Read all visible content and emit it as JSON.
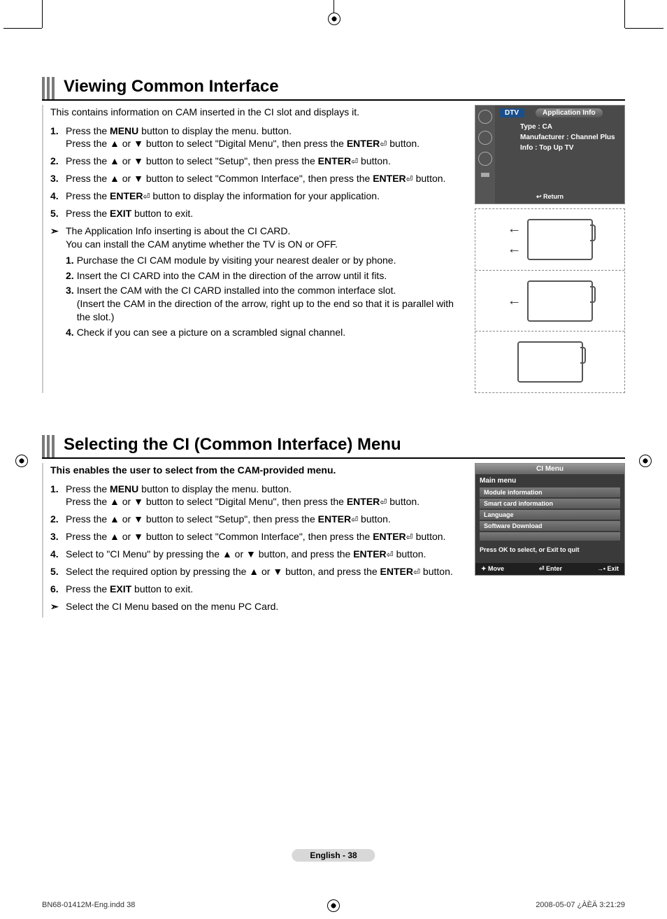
{
  "section1": {
    "title": "Viewing Common Interface",
    "intro": "This contains information on CAM inserted in the CI slot and displays it.",
    "steps": [
      {
        "num": "1.",
        "text_a": "Press the ",
        "b1": "MENU",
        "text_b": " button to display the menu.",
        "line2_a": "Press the ▲ or ▼ button to select \"Digital Menu\", then press the ",
        "b2": "ENTER",
        "tail": " button."
      },
      {
        "num": "2.",
        "text_a": "Press the ▲ or ▼ button to select \"Setup\", then press the ",
        "b1": "ENTER",
        "tail": " button."
      },
      {
        "num": "3.",
        "text_a": "Press the ▲ or ▼ button to select \"Common Interface\", then press the ",
        "b1": "ENTER",
        "tail": " button."
      },
      {
        "num": "4.",
        "text_a": "Press the ",
        "b1": "ENTER",
        "tail": " button to display the information for your application."
      },
      {
        "num": "5.",
        "text_a": "Press the ",
        "b1": "EXIT",
        "tail": " button to exit."
      }
    ],
    "note_line1": "The Application Info inserting is about the CI CARD.",
    "note_line2": "You can install the CAM anytime whether the TV is ON or OFF.",
    "sub": [
      {
        "num": "1.",
        "text": "Purchase the CI CAM module by visiting your nearest dealer or by phone."
      },
      {
        "num": "2.",
        "text": "Insert the CI CARD into the CAM in the direction of the arrow until it fits."
      },
      {
        "num": "3.",
        "text": "Insert the CAM with the CI CARD installed into the common interface slot.",
        "extra": "(Insert the CAM in the direction of the arrow, right up to the end so that it is parallel with the slot.)"
      },
      {
        "num": "4.",
        "text": "Check if you can see a picture on a scrambled signal channel."
      }
    ],
    "app_info": {
      "dtv": "DTV",
      "title": "Application Info",
      "type": "Type : CA",
      "mfr": "Manufacturer : Channel Plus",
      "info": "Info : Top Up TV",
      "return": "↩ Return"
    }
  },
  "section2": {
    "title": "Selecting the CI (Common Interface) Menu",
    "intro": "This enables the user to select from the CAM-provided menu.",
    "steps": [
      {
        "num": "1.",
        "text_a": "Press the ",
        "b1": "MENU",
        "text_b": " button to display the menu.",
        "line2_a": "Press the ▲ or ▼ button to select \"Digital Menu\", then press the ",
        "b2": "ENTER",
        "tail": " button."
      },
      {
        "num": "2.",
        "text_a": "Press the ▲ or ▼ button to select \"Setup\", then press the ",
        "b1": "ENTER",
        "tail": " button."
      },
      {
        "num": "3.",
        "text_a": "Press the ▲ or ▼ button to select \"Common Interface\", then press the ",
        "b1": "ENTER",
        "tail": " button."
      },
      {
        "num": "4.",
        "text_a": "Select to \"CI Menu\" by pressing the ▲ or ▼ button, and press the ",
        "b1": "ENTER",
        "tail": " button."
      },
      {
        "num": "5.",
        "text_a": "Select the required option by pressing the ▲ or ▼ button, and press the ",
        "b1": "ENTER",
        "tail": " button."
      },
      {
        "num": "6.",
        "text_a": "Press the ",
        "b1": "EXIT",
        "tail": " button to exit."
      }
    ],
    "note": "Select the CI Menu based on the menu PC Card.",
    "cimenu": {
      "title": "CI Menu",
      "h2": "Main menu",
      "items": [
        "Module information",
        "Smart card information",
        "Language",
        "Software Download"
      ],
      "help": "Press OK to select, or Exit to quit",
      "footer": {
        "move": "✦ Move",
        "enter": "⏎ Enter",
        "exit": "→• Exit"
      }
    }
  },
  "page_label": "English - 38",
  "doc_footer": {
    "left": "BN68-01412M-Eng.indd   38",
    "right": "2008-05-07   ¿ÀÈÄ 3:21:29"
  },
  "enter_glyph": "⏎"
}
